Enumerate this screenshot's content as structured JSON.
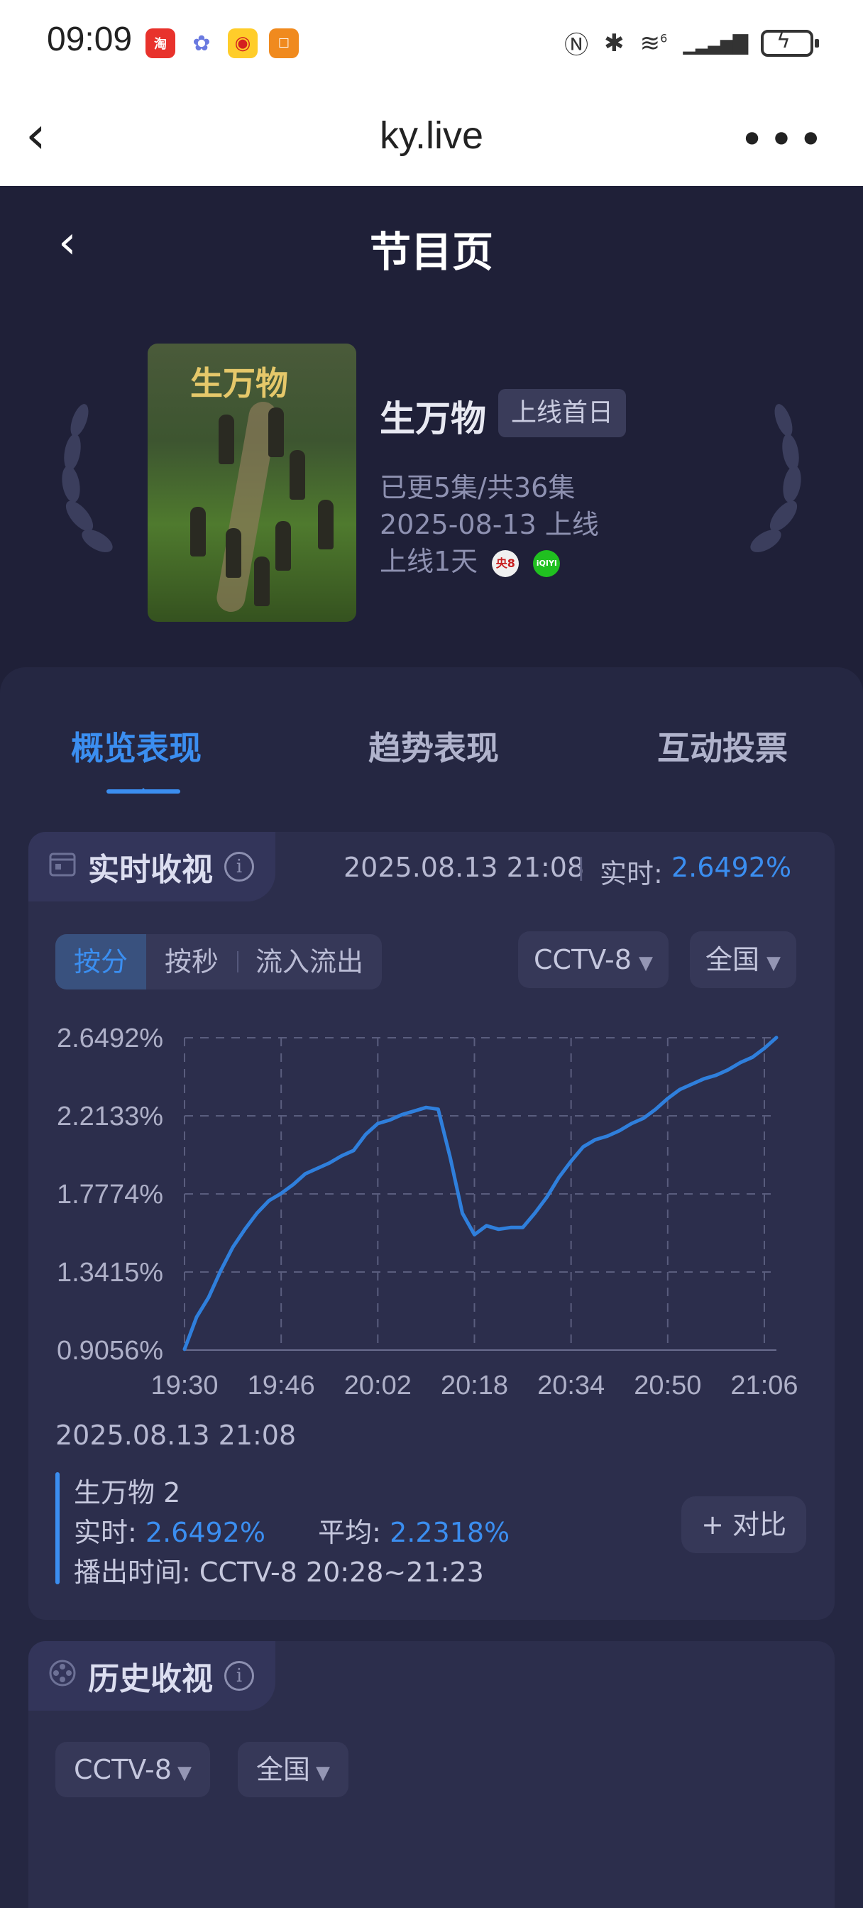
{
  "status_bar": {
    "time": "09:09",
    "apps": [
      "red-app-icon",
      "flower-app-icon",
      "weibo-icon",
      "orange-app-icon"
    ],
    "icons": [
      "nfc-icon",
      "bluetooth-icon",
      "wifi-6-icon",
      "signal-icon",
      "battery-charging-icon"
    ],
    "wifi_label": "6"
  },
  "browser": {
    "title": "ky.live"
  },
  "page": {
    "title": "节目页"
  },
  "show": {
    "name": "生万物",
    "badge": "上线首日",
    "episodes": "已更5集/共36集",
    "release": "2025-08-13 上线",
    "online_days": "上线1天",
    "channels": [
      {
        "label": "央8",
        "bg": "#f0f0f0",
        "fg": "#c81e1e"
      },
      {
        "label": "iQIYI",
        "bg": "#20c020",
        "fg": "#ffffff"
      }
    ],
    "poster_title": "生万物"
  },
  "tabs": [
    {
      "label": "概览表现",
      "active": true
    },
    {
      "label": "趋势表现",
      "active": false
    },
    {
      "label": "互动投票",
      "active": false
    }
  ],
  "realtime": {
    "title": "实时收视",
    "timestamp": "2025.08.13 21:08",
    "label": "实时:",
    "value": "2.6492%",
    "segments": [
      "按分",
      "按秒",
      "流入流出"
    ],
    "channel_select": "CCTV-8",
    "region_select": "全国"
  },
  "chart_data": {
    "type": "line",
    "title": "",
    "xlabel": "",
    "ylabel": "",
    "y_tick_labels": [
      "2.6492%",
      "2.2133%",
      "1.7774%",
      "1.3415%",
      "0.9056%"
    ],
    "x_tick_labels": [
      "19:30",
      "19:46",
      "20:02",
      "20:18",
      "20:34",
      "20:50",
      "21:06"
    ],
    "ylim": [
      0.9056,
      2.6492
    ],
    "xlim": [
      "19:30",
      "21:08"
    ],
    "grid": true,
    "color": "#2f7fdc",
    "series": [
      {
        "name": "生万物 2",
        "x": [
          "19:30",
          "19:32",
          "19:34",
          "19:36",
          "19:38",
          "19:40",
          "19:42",
          "19:44",
          "19:46",
          "19:48",
          "19:50",
          "19:52",
          "19:54",
          "19:56",
          "19:58",
          "20:00",
          "20:02",
          "20:04",
          "20:06",
          "20:08",
          "20:10",
          "20:12",
          "20:14",
          "20:16",
          "20:18",
          "20:20",
          "20:22",
          "20:24",
          "20:26",
          "20:28",
          "20:30",
          "20:32",
          "20:34",
          "20:36",
          "20:38",
          "20:40",
          "20:42",
          "20:44",
          "20:46",
          "20:48",
          "20:50",
          "20:52",
          "20:54",
          "20:56",
          "20:58",
          "21:00",
          "21:02",
          "21:04",
          "21:06",
          "21:08"
        ],
        "values": [
          0.91,
          1.09,
          1.2,
          1.35,
          1.48,
          1.58,
          1.67,
          1.74,
          1.78,
          1.83,
          1.89,
          1.92,
          1.95,
          1.99,
          2.02,
          2.11,
          2.17,
          2.19,
          2.22,
          2.24,
          2.26,
          2.25,
          1.98,
          1.67,
          1.55,
          1.6,
          1.58,
          1.59,
          1.59,
          1.67,
          1.76,
          1.87,
          1.96,
          2.04,
          2.08,
          2.1,
          2.13,
          2.17,
          2.2,
          2.25,
          2.31,
          2.36,
          2.39,
          2.42,
          2.44,
          2.47,
          2.51,
          2.54,
          2.59,
          2.65
        ]
      }
    ]
  },
  "tooltip": {
    "timestamp": "2025.08.13 21:08",
    "series_name": "生万物 2",
    "realtime_label": "实时:",
    "realtime_value": "2.6492%",
    "avg_label": "平均:",
    "avg_value": "2.2318%",
    "airtime_label": "播出时间:",
    "airtime_value": "CCTV-8 20:28~21:23",
    "compare_button": "+ 对比"
  },
  "history": {
    "title": "历史收视",
    "channel_select": "CCTV-8",
    "region_select": "全国"
  }
}
